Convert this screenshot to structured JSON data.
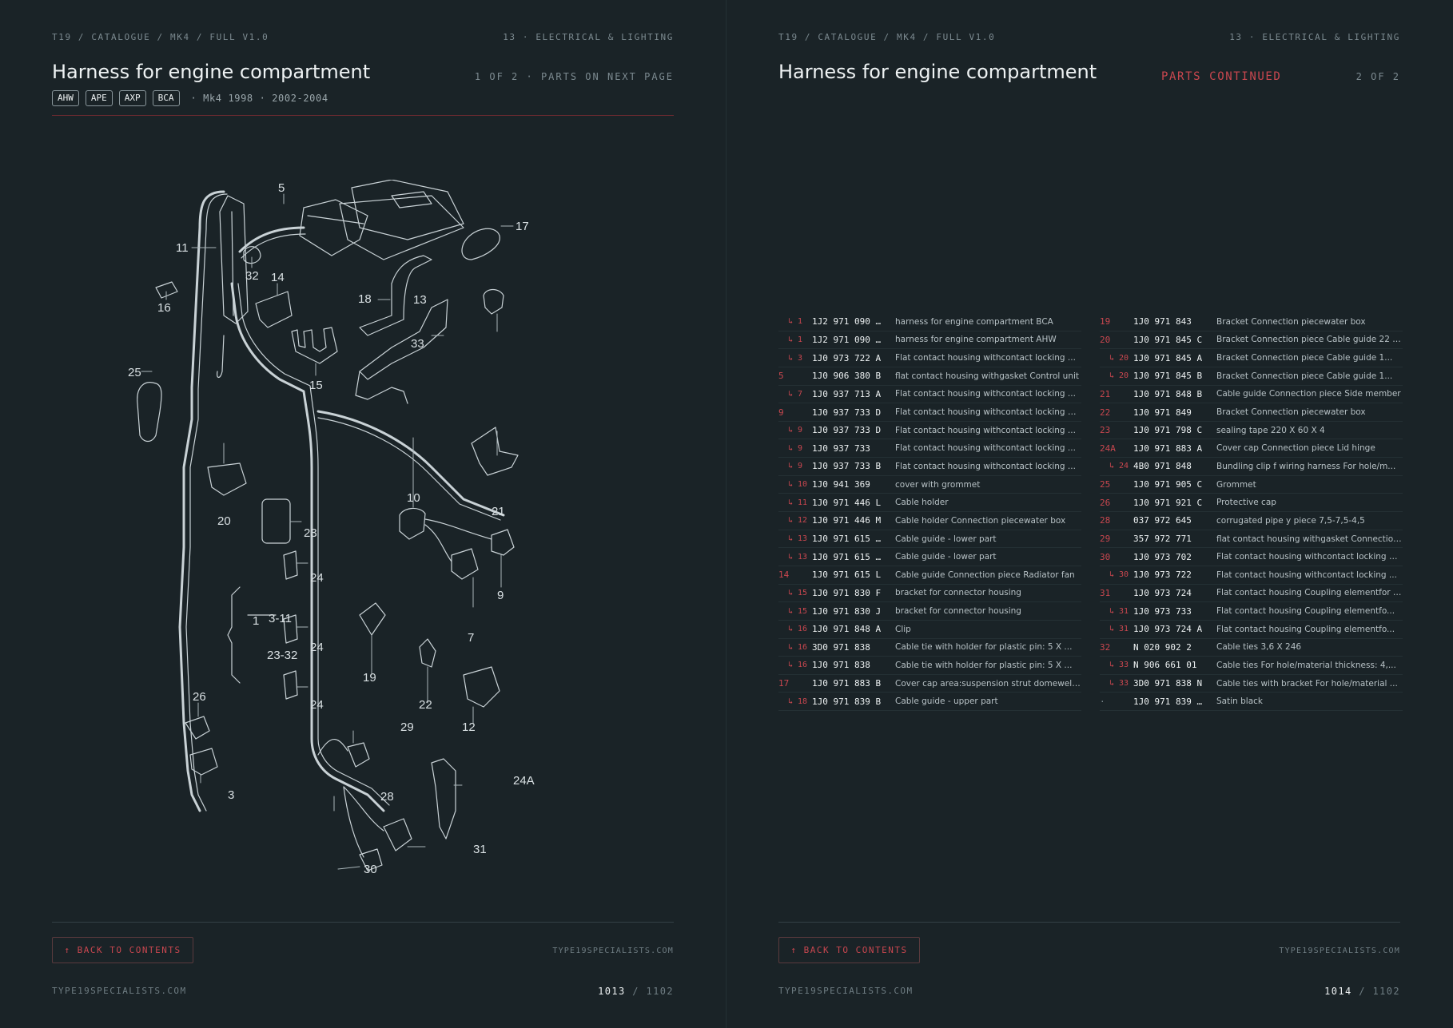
{
  "left": {
    "breadcrumb": "T19 / CATALOGUE / MK4 / FULL V1.0",
    "section": "13 · ELECTRICAL & LIGHTING",
    "title": "Harness for engine compartment",
    "page_info": "1 OF 2 · PARTS ON NEXT PAGE",
    "tags": [
      "AHW",
      "APE",
      "AXP",
      "BCA"
    ],
    "model": "·  Mk4 1998 · 2002-2004",
    "back_label": "↑ BACK TO CONTENTS",
    "site": "TYPE19SPECIALISTS.COM",
    "site_footer": "TYPE19SPECIALISTS.COM",
    "page_current": "1013",
    "page_total": "/ 1102",
    "diagram_labels": [
      "5",
      "17",
      "11",
      "32",
      "14",
      "18",
      "13",
      "16",
      "33",
      "15",
      "25",
      "20",
      "21",
      "10",
      "23",
      "24",
      "9",
      "1",
      "3-11",
      "23-32",
      "24",
      "7",
      "19",
      "22",
      "12",
      "24",
      "26",
      "29",
      "24A",
      "3",
      "28",
      "31",
      "30"
    ]
  },
  "right": {
    "breadcrumb": "T19 / CATALOGUE / MK4 / FULL V1.0",
    "section": "13 · ELECTRICAL & LIGHTING",
    "title": "Harness for engine compartment",
    "continued": "PARTS CONTINUED",
    "page_info": "2 OF 2",
    "back_label": "↑ BACK TO CONTENTS",
    "site": "TYPE19SPECIALISTS.COM",
    "site_footer": "TYPE19SPECIALISTS.COM",
    "page_current": "1014",
    "page_total": "/ 1102"
  },
  "parts_left": [
    {
      "ref": "↳ 1",
      "sub": true,
      "part": "1J2 971 090 …",
      "desc": "harness for engine compartment BCA"
    },
    {
      "ref": "↳ 1",
      "sub": true,
      "part": "1J2 971 090 …",
      "desc": "harness for engine compartment AHW"
    },
    {
      "ref": "↳ 3",
      "sub": true,
      "part": "1J0 973 722 A",
      "desc": "Flat contact housing withcontact locking ..."
    },
    {
      "ref": "5",
      "sub": false,
      "part": "1J0 906 380 B",
      "desc": "flat contact housing withgasket Control unit"
    },
    {
      "ref": "↳ 7",
      "sub": true,
      "part": "1J0 937 713 A",
      "desc": "Flat contact housing withcontact locking ..."
    },
    {
      "ref": "9",
      "sub": false,
      "part": "1J0 937 733 D",
      "desc": "Flat contact housing withcontact locking m..."
    },
    {
      "ref": "↳ 9",
      "sub": true,
      "part": "1J0 937 733 D",
      "desc": "Flat contact housing withcontact locking ..."
    },
    {
      "ref": "↳ 9",
      "sub": true,
      "part": "1J0 937 733",
      "desc": "Flat contact housing withcontact locking ..."
    },
    {
      "ref": "↳ 9",
      "sub": true,
      "part": "1J0 937 733 B",
      "desc": "Flat contact housing withcontact locking ..."
    },
    {
      "ref": "↳ 10",
      "sub": true,
      "part": "1J0 941 369",
      "desc": "cover with grommet"
    },
    {
      "ref": "↳ 11",
      "sub": true,
      "part": "1J0 971 446 L",
      "desc": "Cable holder"
    },
    {
      "ref": "↳ 12",
      "sub": true,
      "part": "1J0 971 446 M",
      "desc": "Cable holder Connection piecewater box"
    },
    {
      "ref": "↳ 13",
      "sub": true,
      "part": "1J0 971 615 …",
      "desc": "Cable guide - lower part"
    },
    {
      "ref": "↳ 13",
      "sub": true,
      "part": "1J0 971 615 …",
      "desc": "Cable guide - lower part"
    },
    {
      "ref": "14",
      "sub": false,
      "part": "1J0 971 615 L",
      "desc": "Cable guide Connection piece Radiator fan"
    },
    {
      "ref": "↳ 15",
      "sub": true,
      "part": "1J0 971 830 F",
      "desc": "bracket for connector housing"
    },
    {
      "ref": "↳ 15",
      "sub": true,
      "part": "1J0 971 830 J",
      "desc": "bracket for connector housing"
    },
    {
      "ref": "↳ 16",
      "sub": true,
      "part": "1J0 971 848 A",
      "desc": "Clip"
    },
    {
      "ref": "↳ 16",
      "sub": true,
      "part": "3D0 971 838",
      "desc": "Cable tie with holder for plastic pin: 5 X ..."
    },
    {
      "ref": "↳ 16",
      "sub": true,
      "part": "1J0 971 838",
      "desc": "Cable tie with holder for plastic pin: 5 X ..."
    },
    {
      "ref": "17",
      "sub": false,
      "part": "1J0 971 883 B",
      "desc": "Cover cap area:suspension strut domeweld..."
    },
    {
      "ref": "↳ 18",
      "sub": true,
      "part": "1J0 971 839 B",
      "desc": "Cable guide - upper part"
    }
  ],
  "parts_right": [
    {
      "ref": "19",
      "sub": false,
      "part": "1J0 971 843",
      "desc": "Bracket Connection piecewater box"
    },
    {
      "ref": "20",
      "sub": false,
      "part": "1J0 971 845 C",
      "desc": "Bracket Connection piece Cable guide 22 X..."
    },
    {
      "ref": "↳ 20",
      "sub": true,
      "part": "1J0 971 845 A",
      "desc": "Bracket Connection piece Cable guide 1..."
    },
    {
      "ref": "↳ 20",
      "sub": true,
      "part": "1J0 971 845 B",
      "desc": "Bracket Connection piece Cable guide 1..."
    },
    {
      "ref": "21",
      "sub": false,
      "part": "1J0 971 848 B",
      "desc": "Cable guide Connection piece Side member"
    },
    {
      "ref": "22",
      "sub": false,
      "part": "1J0 971 849",
      "desc": "Bracket Connection piecewater box"
    },
    {
      "ref": "23",
      "sub": false,
      "part": "1J0 971 798 C",
      "desc": "sealing tape 220 X 60 X 4"
    },
    {
      "ref": "24A",
      "sub": false,
      "part": "1J0 971 883 A",
      "desc": "Cover cap Connection piece Lid hinge"
    },
    {
      "ref": "↳ 24",
      "sub": true,
      "part": "4B0 971 848",
      "desc": "Bundling clip f wiring harness For hole/m..."
    },
    {
      "ref": "25",
      "sub": false,
      "part": "1J0 971 905 C",
      "desc": "Grommet"
    },
    {
      "ref": "26",
      "sub": false,
      "part": "1J0 971 921 C",
      "desc": "Protective cap"
    },
    {
      "ref": "28",
      "sub": false,
      "part": "037 972 645",
      "desc": "corrugated pipe y piece 7,5-7,5-4,5"
    },
    {
      "ref": "29",
      "sub": false,
      "part": "357 972 771",
      "desc": "flat contact housing withgasket Connection..."
    },
    {
      "ref": "30",
      "sub": false,
      "part": "1J0 973 702",
      "desc": "Flat contact housing withcontact locking m..."
    },
    {
      "ref": "↳ 30",
      "sub": true,
      "part": "1J0 973 722",
      "desc": "Flat contact housing withcontact locking ..."
    },
    {
      "ref": "31",
      "sub": false,
      "part": "1J0 973 724",
      "desc": "Flat contact housing Coupling elementfor la..."
    },
    {
      "ref": "↳ 31",
      "sub": true,
      "part": "1J0 973 733",
      "desc": "Flat contact housing Coupling elementfo..."
    },
    {
      "ref": "↳ 31",
      "sub": true,
      "part": "1J0 973 724 A",
      "desc": "Flat contact housing Coupling elementfo..."
    },
    {
      "ref": "32",
      "sub": false,
      "part": "N 020 902 2",
      "desc": "Cable ties 3,6 X 246"
    },
    {
      "ref": "↳ 33",
      "sub": true,
      "part": "N 906 661 01",
      "desc": "Cable ties For hole/material thickness: 4,..."
    },
    {
      "ref": "↳ 33",
      "sub": true,
      "part": "3D0 971 838 N",
      "desc": "Cable ties with bracket For hole/material ..."
    },
    {
      "ref": "·",
      "sub": false,
      "dot": true,
      "part": "1J0 971 839 …",
      "desc": "Satin black"
    }
  ]
}
